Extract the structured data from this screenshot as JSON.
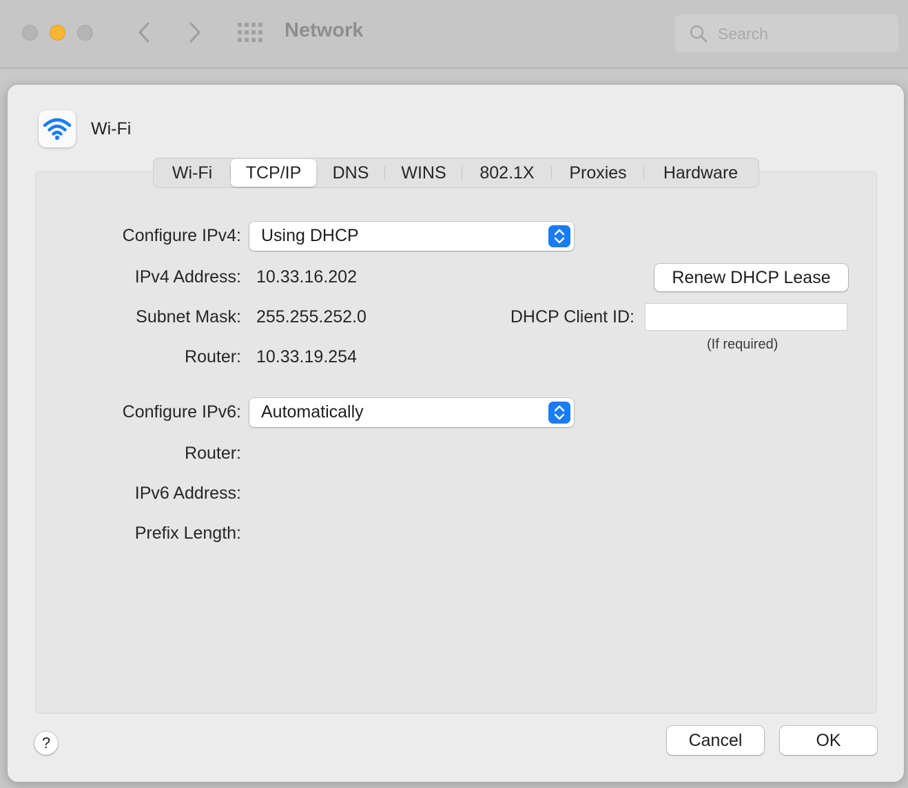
{
  "window": {
    "title": "Network",
    "search_placeholder": "Search"
  },
  "sheet": {
    "header_label": "Wi-Fi",
    "header_icon": "wifi-icon",
    "tabs": [
      {
        "label": "Wi-Fi",
        "active": false
      },
      {
        "label": "TCP/IP",
        "active": true
      },
      {
        "label": "DNS",
        "active": false
      },
      {
        "label": "WINS",
        "active": false
      },
      {
        "label": "802.1X",
        "active": false
      },
      {
        "label": "Proxies",
        "active": false
      },
      {
        "label": "Hardware",
        "active": false
      }
    ],
    "ipv4": {
      "configure_label": "Configure IPv4:",
      "configure_value": "Using DHCP",
      "address_label": "IPv4 Address:",
      "address_value": "10.33.16.202",
      "subnet_label": "Subnet Mask:",
      "subnet_value": "255.255.252.0",
      "router_label": "Router:",
      "router_value": "10.33.19.254",
      "renew_button": "Renew DHCP Lease",
      "client_id_label": "DHCP Client ID:",
      "client_id_value": "",
      "client_id_hint": "(If required)"
    },
    "ipv6": {
      "configure_label": "Configure IPv6:",
      "configure_value": "Automatically",
      "router_label": "Router:",
      "address_label": "IPv6 Address:",
      "prefix_label": "Prefix Length:"
    },
    "buttons": {
      "help": "?",
      "cancel": "Cancel",
      "ok": "OK"
    }
  },
  "colors": {
    "accent": "#1a7cf5",
    "traffic_min": "#f6b632"
  }
}
